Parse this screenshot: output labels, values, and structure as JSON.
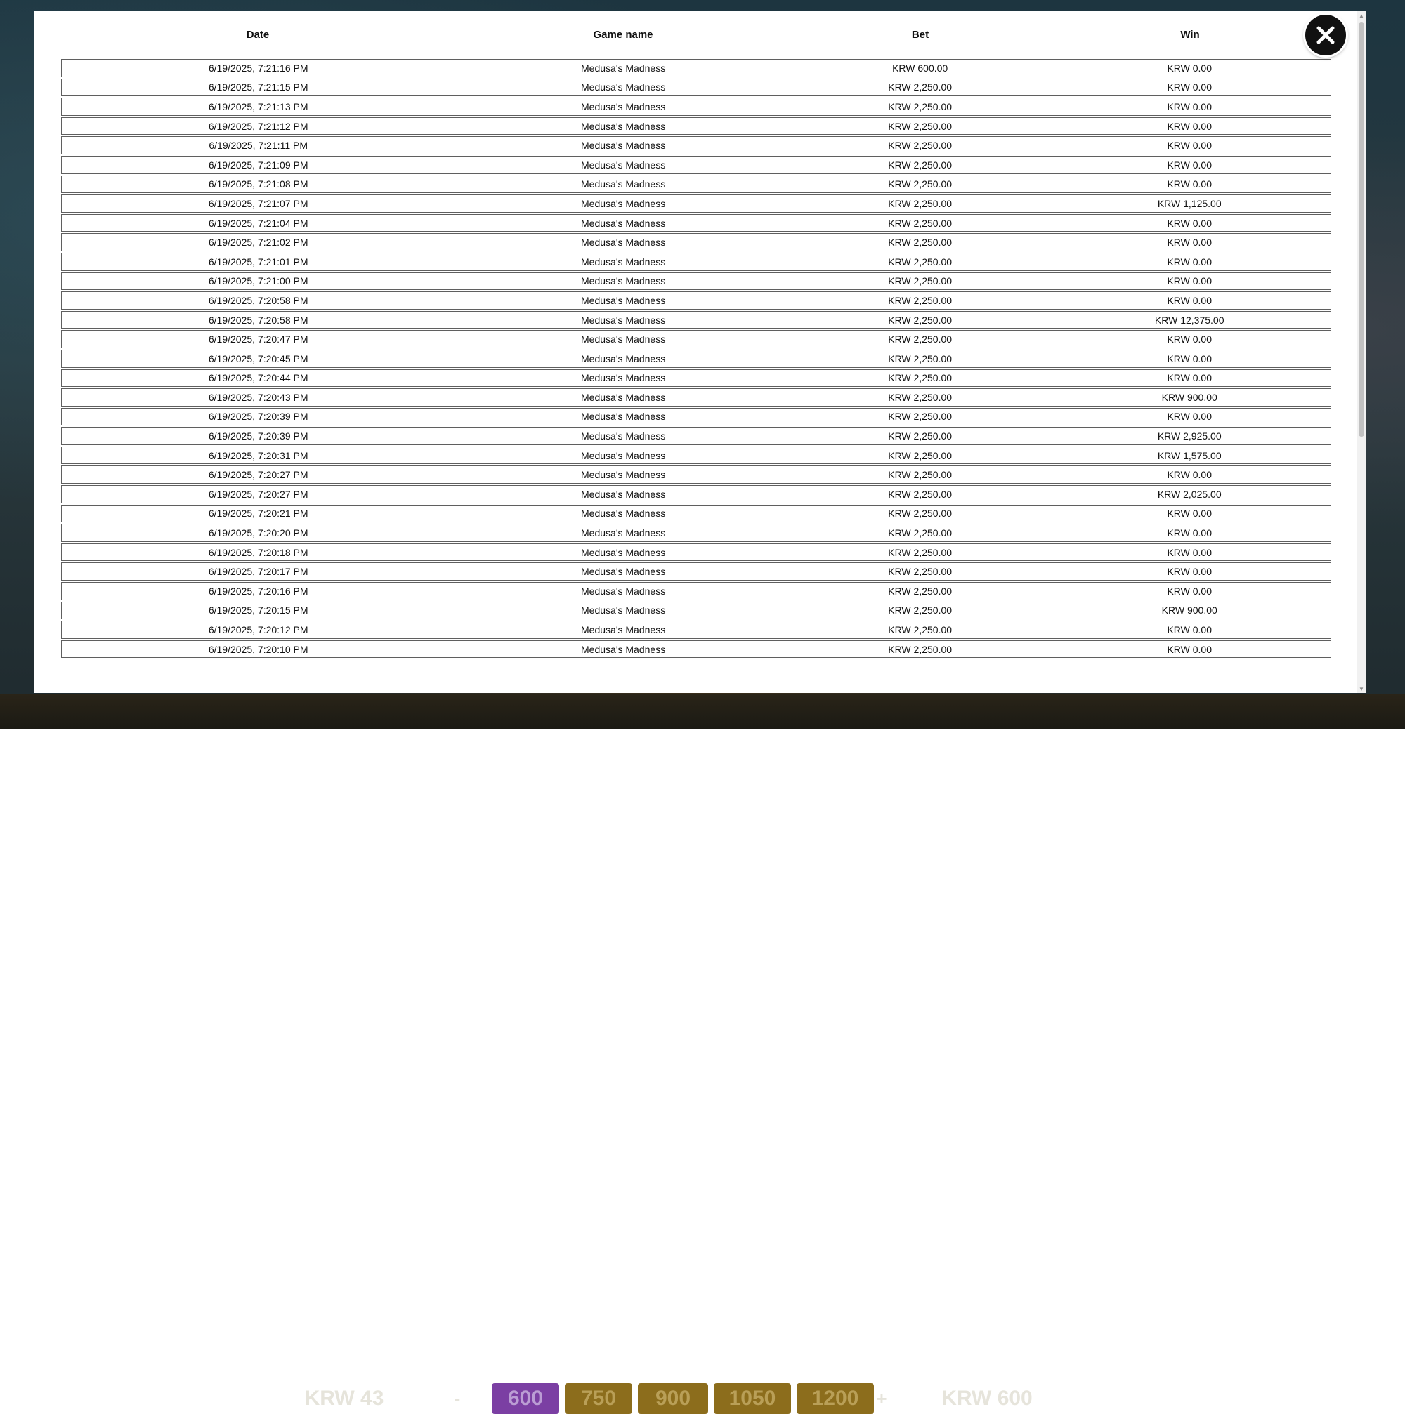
{
  "background": {
    "bet_chips": [
      "600",
      "750",
      "900",
      "1050",
      "1200"
    ],
    "balance_label": "KRW 43",
    "bet_label": "KRW 600"
  },
  "table": {
    "headers": {
      "date": "Date",
      "game": "Game name",
      "bet": "Bet",
      "win": "Win"
    },
    "rows": [
      {
        "date": "6/19/2025, 7:21:16 PM",
        "game": "Medusa's Madness",
        "bet": "KRW 600.00",
        "win": "KRW 0.00"
      },
      {
        "date": "6/19/2025, 7:21:15 PM",
        "game": "Medusa's Madness",
        "bet": "KRW 2,250.00",
        "win": "KRW 0.00"
      },
      {
        "date": "6/19/2025, 7:21:13 PM",
        "game": "Medusa's Madness",
        "bet": "KRW 2,250.00",
        "win": "KRW 0.00"
      },
      {
        "date": "6/19/2025, 7:21:12 PM",
        "game": "Medusa's Madness",
        "bet": "KRW 2,250.00",
        "win": "KRW 0.00"
      },
      {
        "date": "6/19/2025, 7:21:11 PM",
        "game": "Medusa's Madness",
        "bet": "KRW 2,250.00",
        "win": "KRW 0.00"
      },
      {
        "date": "6/19/2025, 7:21:09 PM",
        "game": "Medusa's Madness",
        "bet": "KRW 2,250.00",
        "win": "KRW 0.00"
      },
      {
        "date": "6/19/2025, 7:21:08 PM",
        "game": "Medusa's Madness",
        "bet": "KRW 2,250.00",
        "win": "KRW 0.00"
      },
      {
        "date": "6/19/2025, 7:21:07 PM",
        "game": "Medusa's Madness",
        "bet": "KRW 2,250.00",
        "win": "KRW 1,125.00"
      },
      {
        "date": "6/19/2025, 7:21:04 PM",
        "game": "Medusa's Madness",
        "bet": "KRW 2,250.00",
        "win": "KRW 0.00"
      },
      {
        "date": "6/19/2025, 7:21:02 PM",
        "game": "Medusa's Madness",
        "bet": "KRW 2,250.00",
        "win": "KRW 0.00"
      },
      {
        "date": "6/19/2025, 7:21:01 PM",
        "game": "Medusa's Madness",
        "bet": "KRW 2,250.00",
        "win": "KRW 0.00"
      },
      {
        "date": "6/19/2025, 7:21:00 PM",
        "game": "Medusa's Madness",
        "bet": "KRW 2,250.00",
        "win": "KRW 0.00"
      },
      {
        "date": "6/19/2025, 7:20:58 PM",
        "game": "Medusa's Madness",
        "bet": "KRW 2,250.00",
        "win": "KRW 0.00"
      },
      {
        "date": "6/19/2025, 7:20:58 PM",
        "game": "Medusa's Madness",
        "bet": "KRW 2,250.00",
        "win": "KRW 12,375.00"
      },
      {
        "date": "6/19/2025, 7:20:47 PM",
        "game": "Medusa's Madness",
        "bet": "KRW 2,250.00",
        "win": "KRW 0.00"
      },
      {
        "date": "6/19/2025, 7:20:45 PM",
        "game": "Medusa's Madness",
        "bet": "KRW 2,250.00",
        "win": "KRW 0.00"
      },
      {
        "date": "6/19/2025, 7:20:44 PM",
        "game": "Medusa's Madness",
        "bet": "KRW 2,250.00",
        "win": "KRW 0.00"
      },
      {
        "date": "6/19/2025, 7:20:43 PM",
        "game": "Medusa's Madness",
        "bet": "KRW 2,250.00",
        "win": "KRW 900.00"
      },
      {
        "date": "6/19/2025, 7:20:39 PM",
        "game": "Medusa's Madness",
        "bet": "KRW 2,250.00",
        "win": "KRW 0.00"
      },
      {
        "date": "6/19/2025, 7:20:39 PM",
        "game": "Medusa's Madness",
        "bet": "KRW 2,250.00",
        "win": "KRW 2,925.00"
      },
      {
        "date": "6/19/2025, 7:20:31 PM",
        "game": "Medusa's Madness",
        "bet": "KRW 2,250.00",
        "win": "KRW 1,575.00"
      },
      {
        "date": "6/19/2025, 7:20:27 PM",
        "game": "Medusa's Madness",
        "bet": "KRW 2,250.00",
        "win": "KRW 0.00"
      },
      {
        "date": "6/19/2025, 7:20:27 PM",
        "game": "Medusa's Madness",
        "bet": "KRW 2,250.00",
        "win": "KRW 2,025.00"
      },
      {
        "date": "6/19/2025, 7:20:21 PM",
        "game": "Medusa's Madness",
        "bet": "KRW 2,250.00",
        "win": "KRW 0.00"
      },
      {
        "date": "6/19/2025, 7:20:20 PM",
        "game": "Medusa's Madness",
        "bet": "KRW 2,250.00",
        "win": "KRW 0.00"
      },
      {
        "date": "6/19/2025, 7:20:18 PM",
        "game": "Medusa's Madness",
        "bet": "KRW 2,250.00",
        "win": "KRW 0.00"
      },
      {
        "date": "6/19/2025, 7:20:17 PM",
        "game": "Medusa's Madness",
        "bet": "KRW 2,250.00",
        "win": "KRW 0.00"
      },
      {
        "date": "6/19/2025, 7:20:16 PM",
        "game": "Medusa's Madness",
        "bet": "KRW 2,250.00",
        "win": "KRW 0.00"
      },
      {
        "date": "6/19/2025, 7:20:15 PM",
        "game": "Medusa's Madness",
        "bet": "KRW 2,250.00",
        "win": "KRW 900.00"
      },
      {
        "date": "6/19/2025, 7:20:12 PM",
        "game": "Medusa's Madness",
        "bet": "KRW 2,250.00",
        "win": "KRW 0.00"
      },
      {
        "date": "6/19/2025, 7:20:10 PM",
        "game": "Medusa's Madness",
        "bet": "KRW 2,250.00",
        "win": "KRW 0.00"
      }
    ]
  }
}
